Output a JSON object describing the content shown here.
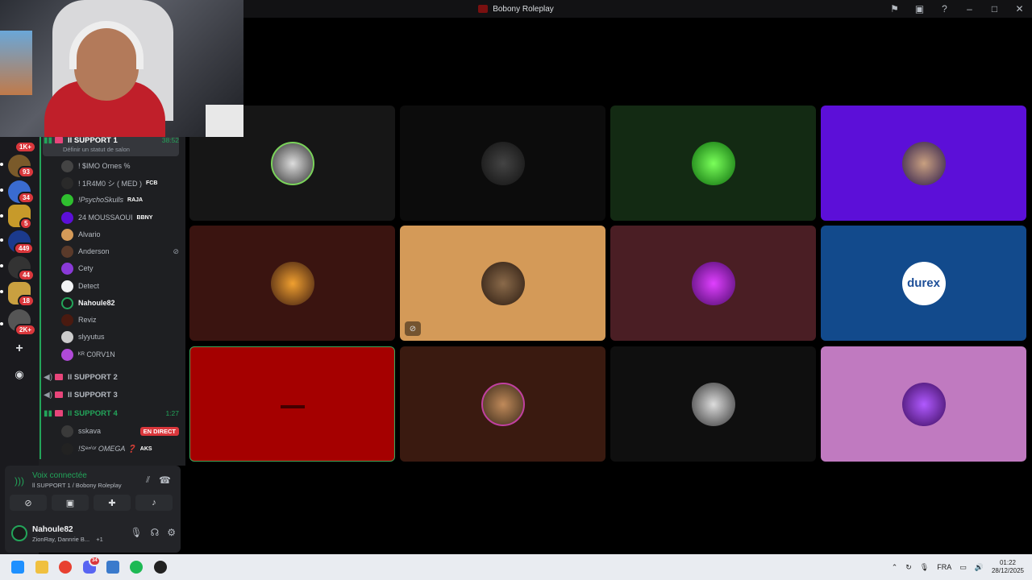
{
  "window": {
    "title": "Bobony Roleplay"
  },
  "servers": {
    "badges": [
      "1K+",
      "93",
      "34",
      "5",
      "449",
      "44",
      "18",
      "2K+"
    ]
  },
  "channels": {
    "support1": {
      "name": "ll SUPPORT 1",
      "time": "38:52",
      "status_hint": "Définir un statut de salon"
    },
    "support1_users": [
      {
        "name": "! $IMO Ornes %",
        "tag": ""
      },
      {
        "name": "! 1R4M0 シ ( MED )",
        "tag": "FCB"
      },
      {
        "name": "!PsychoSkulls",
        "tag": "RAJA"
      },
      {
        "name": "24 MOUSSAOUI",
        "tag": "BBNY"
      },
      {
        "name": "Alvario",
        "tag": ""
      },
      {
        "name": "Anderson",
        "tag": ""
      },
      {
        "name": "Cety",
        "tag": ""
      },
      {
        "name": "Detect",
        "tag": ""
      },
      {
        "name": "Nahoule82",
        "tag": ""
      },
      {
        "name": "Reviz",
        "tag": ""
      },
      {
        "name": "slyyutus",
        "tag": ""
      },
      {
        "name": "ᴷᴿ C0RV1N",
        "tag": ""
      }
    ],
    "support2": {
      "name": "ll SUPPORT 2"
    },
    "support3": {
      "name": "ll SUPPORT 3"
    },
    "support4": {
      "name": "ll SUPPORT 4",
      "time": "1:27"
    },
    "support4_users": [
      {
        "name": "sskava",
        "tag": "EN DIRECT"
      },
      {
        "name": "!Sᵉⁿⁱᵒʳ OMEGA ❓",
        "tag": "AKS"
      }
    ]
  },
  "voice": {
    "status": "Voix connectée",
    "channel": "ll SUPPORT 1 / Bobony Roleplay"
  },
  "user": {
    "name": "Nahoule82",
    "status": "ZionRay, Dannrie B...",
    "extra": "+1"
  },
  "tiles": {
    "durex_label": "durex"
  },
  "taskbar": {
    "language": "FRA",
    "time": "01:22",
    "date": "28/12/2025",
    "discord_badge": "34"
  },
  "colors": {
    "voice_green": "#23a55a",
    "live_red": "#da373c",
    "tile_purple": "#5c0fd8",
    "tile_tan": "#d49a58",
    "tile_blue": "#124a8c",
    "tile_pink": "#c07ac0",
    "tile_red": "#a50000"
  }
}
